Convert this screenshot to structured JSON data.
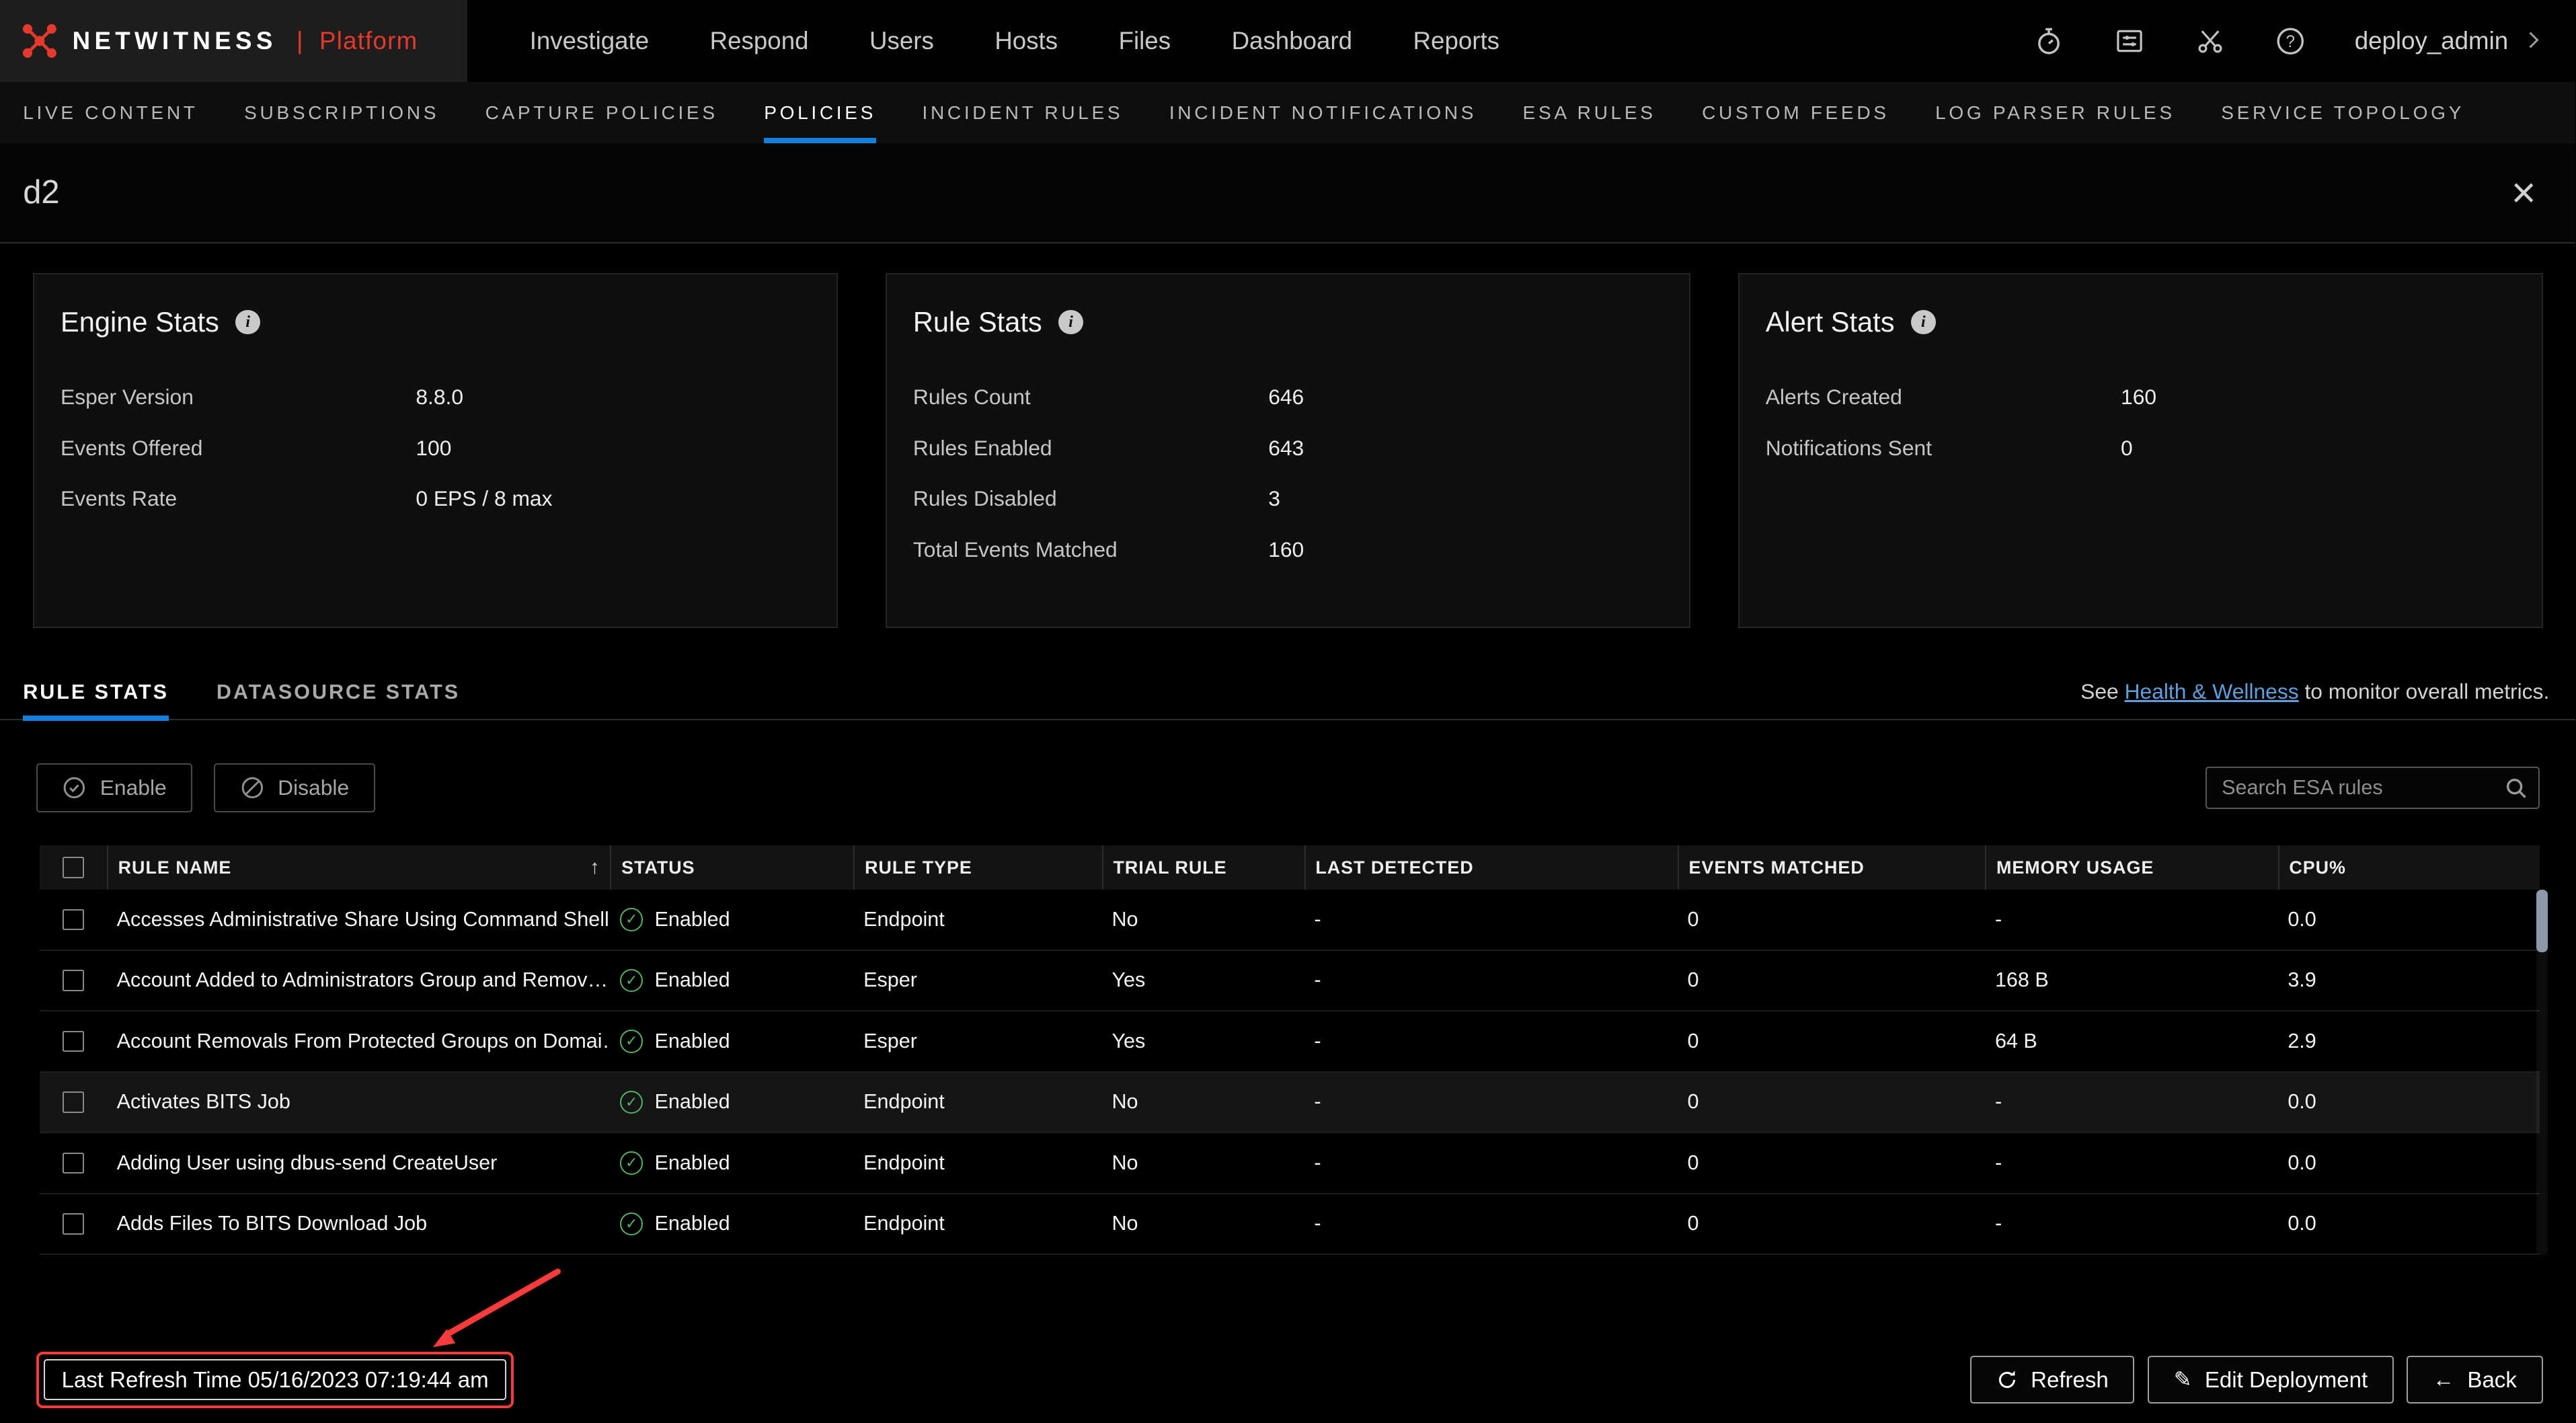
{
  "colors": {
    "accent_blue": "#1380e0",
    "brand_red": "#e5392c",
    "status_green": "#52b365",
    "annotation_red": "#fb3b3b",
    "link_blue": "#5fa0dc"
  },
  "icons": {
    "close": "×",
    "sort_asc": "↑",
    "check": "✓",
    "pencil": "✎",
    "back_arrow": "←",
    "info": "i"
  },
  "brand": {
    "name": "NETWITNESS",
    "separator": "|",
    "product": "Platform"
  },
  "top_nav": {
    "items": [
      "Investigate",
      "Respond",
      "Users",
      "Hosts",
      "Files",
      "Dashboard",
      "Reports"
    ],
    "header_icons": [
      "timer-icon",
      "system-monitor-icon",
      "tools-icon",
      "help-icon"
    ],
    "user": "deploy_admin"
  },
  "secondary_nav": {
    "items": [
      {
        "label": "LIVE CONTENT",
        "active": false
      },
      {
        "label": "SUBSCRIPTIONS",
        "active": false
      },
      {
        "label": "CAPTURE POLICIES",
        "active": false
      },
      {
        "label": "POLICIES",
        "active": true
      },
      {
        "label": "INCIDENT RULES",
        "active": false
      },
      {
        "label": "INCIDENT NOTIFICATIONS",
        "active": false
      },
      {
        "label": "ESA RULES",
        "active": false
      },
      {
        "label": "CUSTOM FEEDS",
        "active": false
      },
      {
        "label": "LOG PARSER RULES",
        "active": false
      },
      {
        "label": "SERVICE TOPOLOGY",
        "active": false
      }
    ]
  },
  "page": {
    "title": "d2"
  },
  "panels": {
    "engine": {
      "title": "Engine Stats",
      "rows": [
        {
          "label": "Esper Version",
          "value": "8.8.0"
        },
        {
          "label": "Events Offered",
          "value": "100"
        },
        {
          "label": "Events Rate",
          "value": "0 EPS / 8 max"
        }
      ]
    },
    "rule": {
      "title": "Rule Stats",
      "rows": [
        {
          "label": "Rules Count",
          "value": "646"
        },
        {
          "label": "Rules Enabled",
          "value": "643"
        },
        {
          "label": "Rules Disabled",
          "value": "3"
        },
        {
          "label": "Total Events Matched",
          "value": "160"
        }
      ]
    },
    "alert": {
      "title": "Alert Stats",
      "rows": [
        {
          "label": "Alerts Created",
          "value": "160"
        },
        {
          "label": "Notifications Sent",
          "value": "0"
        }
      ]
    }
  },
  "tabs": {
    "items": [
      {
        "label": "RULE STATS",
        "active": true
      },
      {
        "label": "DATASOURCE STATS",
        "active": false
      }
    ],
    "note": {
      "prefix": "See ",
      "link": "Health & Wellness",
      "suffix": " to monitor overall metrics."
    }
  },
  "toolbar": {
    "enable": "Enable",
    "disable": "Disable",
    "search_placeholder": "Search ESA rules"
  },
  "table": {
    "columns": [
      "RULE NAME",
      "STATUS",
      "RULE TYPE",
      "TRIAL RULE",
      "LAST DETECTED",
      "EVENTS MATCHED",
      "MEMORY USAGE",
      "CPU%"
    ],
    "rows": [
      {
        "name": "Accesses Administrative Share Using Command Shell",
        "status": "Enabled",
        "type": "Endpoint",
        "trial": "No",
        "last_detected": "-",
        "events": "0",
        "memory": "-",
        "cpu": "0.0"
      },
      {
        "name": "Account Added to Administrators Group and Remov…",
        "status": "Enabled",
        "type": "Esper",
        "trial": "Yes",
        "last_detected": "-",
        "events": "0",
        "memory": "168 B",
        "cpu": "3.9"
      },
      {
        "name": "Account Removals From Protected Groups on Domai…",
        "status": "Enabled",
        "type": "Esper",
        "trial": "Yes",
        "last_detected": "-",
        "events": "0",
        "memory": "64 B",
        "cpu": "2.9"
      },
      {
        "name": "Activates BITS Job",
        "status": "Enabled",
        "type": "Endpoint",
        "trial": "No",
        "last_detected": "-",
        "events": "0",
        "memory": "-",
        "cpu": "0.0",
        "highlighted": true
      },
      {
        "name": "Adding User using dbus-send CreateUser",
        "status": "Enabled",
        "type": "Endpoint",
        "trial": "No",
        "last_detected": "-",
        "events": "0",
        "memory": "-",
        "cpu": "0.0"
      },
      {
        "name": "Adds Files To BITS Download Job",
        "status": "Enabled",
        "type": "Endpoint",
        "trial": "No",
        "last_detected": "-",
        "events": "0",
        "memory": "-",
        "cpu": "0.0"
      }
    ]
  },
  "footer": {
    "last_refresh": "Last Refresh Time 05/16/2023 07:19:44 am",
    "refresh": "Refresh",
    "edit": "Edit Deployment",
    "back": "Back"
  }
}
